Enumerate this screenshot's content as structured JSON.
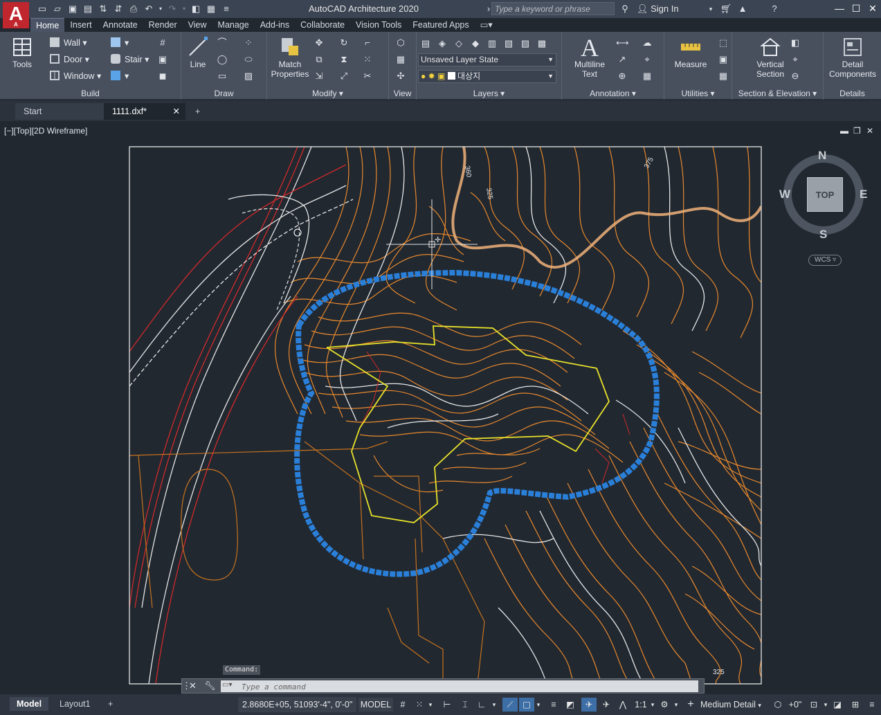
{
  "app": {
    "logo_letter": "A",
    "logo_sub": "A",
    "title": "AutoCAD Architecture 2020",
    "search_placeholder": "Type a keyword or phrase",
    "sign_in": "Sign In"
  },
  "ribbon_tabs": [
    "Home",
    "Insert",
    "Annotate",
    "Render",
    "View",
    "Manage",
    "Add-ins",
    "Collaborate",
    "Vision Tools",
    "Featured Apps"
  ],
  "panels": {
    "build": {
      "label": "Build",
      "tools_label": "Tools",
      "wall": "Wall",
      "door": "Door",
      "window": "Window",
      "stair": "Stair"
    },
    "draw": {
      "label": "Draw",
      "line": "Line"
    },
    "modify": {
      "label": "Modify",
      "match_properties_1": "Match",
      "match_properties_2": "Properties"
    },
    "view": {
      "label": "View"
    },
    "layers": {
      "label": "Layers",
      "layer_state": "Unsaved Layer State",
      "current_layer": "대상지"
    },
    "annotation": {
      "label": "Annotation",
      "multiline_1": "Multiline",
      "multiline_2": "Text"
    },
    "utilities": {
      "label": "Utilities",
      "measure": "Measure"
    },
    "section": {
      "label": "Section & Elevation",
      "vertical_1": "Vertical",
      "vertical_2": "Section"
    },
    "details": {
      "label": "Details",
      "detail_1": "Detail",
      "detail_2": "Components"
    }
  },
  "doc_tabs": {
    "start": "Start",
    "current": "1111.dxf*"
  },
  "viewport": {
    "label": "[−][Top][2D Wireframe]",
    "contour_labels": [
      "360",
      "325",
      "375",
      "325"
    ]
  },
  "viewcube": {
    "north": "N",
    "south": "S",
    "east": "E",
    "west": "W",
    "face": "TOP",
    "wcs": "WCS"
  },
  "command": {
    "label": "Command:",
    "placeholder": "Type a command"
  },
  "status": {
    "model_tab": "Model",
    "layout_tab": "Layout1",
    "coordinates": "2.8680E+05, 51093'-4\", 0'-0\"",
    "model_button": "MODEL",
    "scale": "1:1",
    "detail_level": "Medium Detail",
    "elevation": "+0\""
  },
  "colors": {
    "contour_orange": "#e8892e",
    "contour_white": "#e6e6e6",
    "boundary_blue": "#2a7fd8",
    "site_yellow": "#e8e22a",
    "road_red": "#d22a2a"
  }
}
